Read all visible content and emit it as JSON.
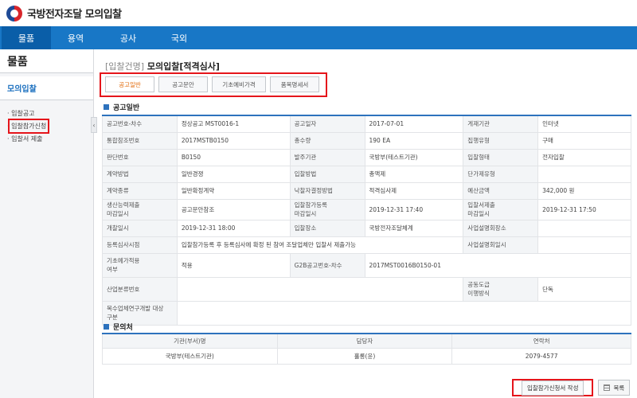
{
  "app": {
    "title": "국방전자조달 모의입찰"
  },
  "nav": {
    "items": [
      "물품",
      "용역",
      "공사",
      "국외"
    ],
    "active": 0
  },
  "sidebar": {
    "title": "물품",
    "section": "모의입찰",
    "items": [
      "입찰공고",
      "입찰참가신청",
      "입찰서 제출"
    ],
    "highlighted": 1
  },
  "page": {
    "crumb": "[입찰건명]",
    "title": "모의입찰[적격심사]"
  },
  "tabs": [
    "공고일반",
    "공고문안",
    "기초예비가격",
    "품목명세서"
  ],
  "sections": {
    "general": "공고일반",
    "contact": "문의처"
  },
  "info": {
    "r1": [
      "공고번호-차수",
      "정상공고 MST0016-1",
      "공고일자",
      "2017-07-01",
      "게재기관",
      "인터넷"
    ],
    "r2": [
      "통합참조번호",
      "2017MSTB0150",
      "총수량",
      "190 EA",
      "집행유형",
      "구매"
    ],
    "r3": [
      "판단번호",
      "B0150",
      "발주기관",
      "국방부(테스트기관)",
      "입찰형태",
      "전자입찰"
    ],
    "r4": [
      "계약방법",
      "일반경쟁",
      "입찰방법",
      "총액제",
      "단가제유형",
      ""
    ],
    "r5": [
      "계약종류",
      "일반확정계약",
      "낙찰자결정방법",
      "적격심사제",
      "예산금액",
      "342,000 원"
    ],
    "r6": [
      "생산능력제출\n마감일시",
      "공고문안참조",
      "입찰참가등록\n마감일시",
      "2019-12-31 17:40",
      "입찰서제출\n마감일시",
      "2019-12-31 17:50"
    ],
    "r7": [
      "개찰일시",
      "2019-12-31 18:00",
      "입찰장소",
      "국방전자조달체계",
      "사업설명회장소",
      ""
    ],
    "r8": [
      "등록심사시점",
      "입찰참가등록 후 등록심사에 확정 된 참여 조달업체만 입찰서 제출가능",
      "사업설명회일시",
      ""
    ],
    "r9": [
      "기초예가적용\n여부",
      "적용",
      "G2B공고번호-차수",
      "2017MST0016B0150-01"
    ],
    "r10": [
      "산업분류번호",
      "",
      "공동도급\n이행방식",
      "단독"
    ],
    "r11": [
      "복수업체연구개발 대상\n구분",
      ""
    ]
  },
  "contact": {
    "headers": [
      "기관(부서)명",
      "담당자",
      "연락처"
    ],
    "row": [
      "국방부(테스트기관)",
      "홀롱(윤)",
      "2079-4577"
    ]
  },
  "buttons": {
    "apply": "입찰참가신청서 작성",
    "list": "목록"
  }
}
